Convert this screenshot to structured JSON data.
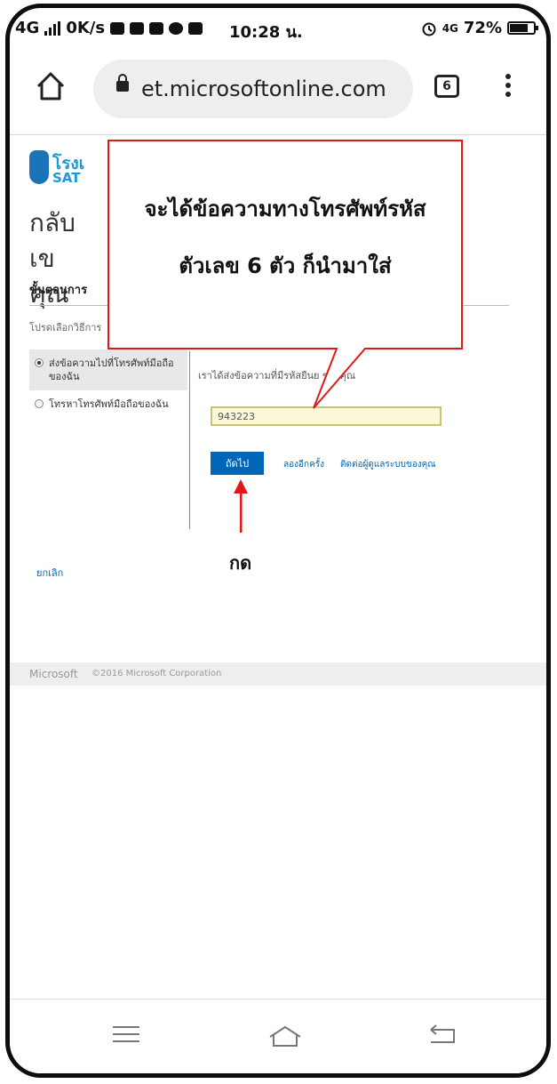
{
  "status_bar": {
    "network": "4G",
    "speed": "0K/s",
    "time": "10:28 น.",
    "network_right": "4G",
    "battery": "72%"
  },
  "browser": {
    "url": "et.microsoftonline.com",
    "tab_count": "6"
  },
  "page": {
    "logo_text_1": "โรงเ",
    "logo_text_2": "SAT",
    "title": "กลับเข คุณ",
    "steps_heading": "ขั้นตอนการ",
    "choose_method": "โปรดเลือกวิธีการ",
    "options": [
      {
        "label": "ส่งข้อความไปที่โทรศัพท์มือถือของฉัน",
        "selected": true
      },
      {
        "label": "โทรหาโทรศัพท์มือถือของฉัน",
        "selected": false
      }
    ],
    "sent_message": "เราได้ส่งข้อความที่มีรหัสยืนย                ของคุณ",
    "code_value": "943223",
    "next_button": "ถัดไป",
    "resend_link": "ลองอีกครั้ง",
    "contact_link": "ติดต่อผู้ดูแลระบบของคุณ",
    "cancel_link": "ยกเลิก"
  },
  "footer": {
    "brand": "Microsoft",
    "copyright": "©2016 Microsoft Corporation"
  },
  "annotations": {
    "callout_line_1": "จะได้ข้อความทางโทรศัพท์รหัส",
    "callout_line_2": "ตัวเลข 6 ตัว ก็นำมาใส่",
    "press_label": "กด",
    "annotation_color": "#e01818"
  }
}
